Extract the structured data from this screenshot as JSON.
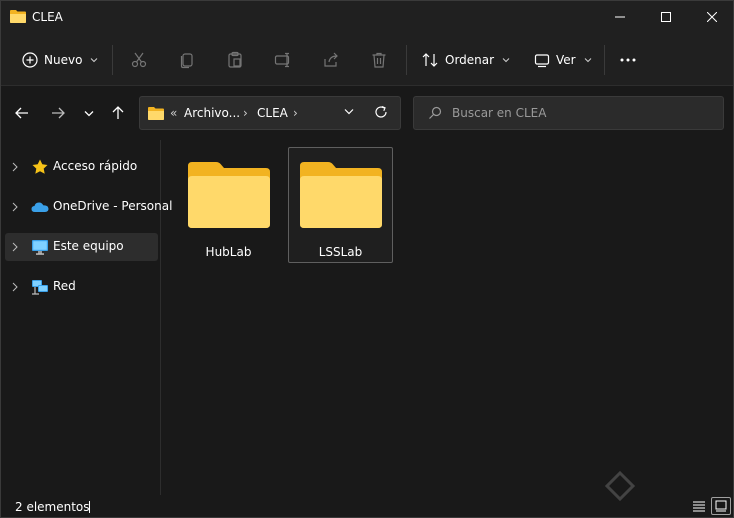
{
  "window": {
    "title": "CLEA",
    "controls": [
      "minimize-icon",
      "maximize-icon",
      "close-icon"
    ]
  },
  "toolbar": {
    "new_label": "Nuevo",
    "sort_label": "Ordenar",
    "view_label": "Ver",
    "icons": [
      "cut-icon",
      "copy-icon",
      "paste-icon",
      "rename-icon",
      "share-icon",
      "delete-icon",
      "more-icon"
    ]
  },
  "address": {
    "overflow": "«",
    "crumbs": [
      "Archivo...",
      "CLEA"
    ],
    "separator": "›"
  },
  "search": {
    "placeholder": "Buscar en CLEA",
    "value": ""
  },
  "sidebar": {
    "items": [
      {
        "label": "Acceso rápido",
        "icon": "star-icon"
      },
      {
        "label": "OneDrive - Personal",
        "icon": "cloud-icon"
      },
      {
        "label": "Este equipo",
        "icon": "computer-icon",
        "selected": true
      },
      {
        "label": "Red",
        "icon": "network-icon"
      }
    ]
  },
  "files": [
    {
      "name": "HubLab",
      "icon": "folder-icon"
    },
    {
      "name": "LSSLab",
      "icon": "folder-icon",
      "selected": true
    }
  ],
  "status": {
    "count": "2 elementos"
  },
  "colors": {
    "background": "#191919",
    "chrome": "#202020",
    "folder_light": "#ffd96a",
    "folder_dark": "#f2b321",
    "accent_blue": "#3aa0e8",
    "star": "#f5c218"
  }
}
